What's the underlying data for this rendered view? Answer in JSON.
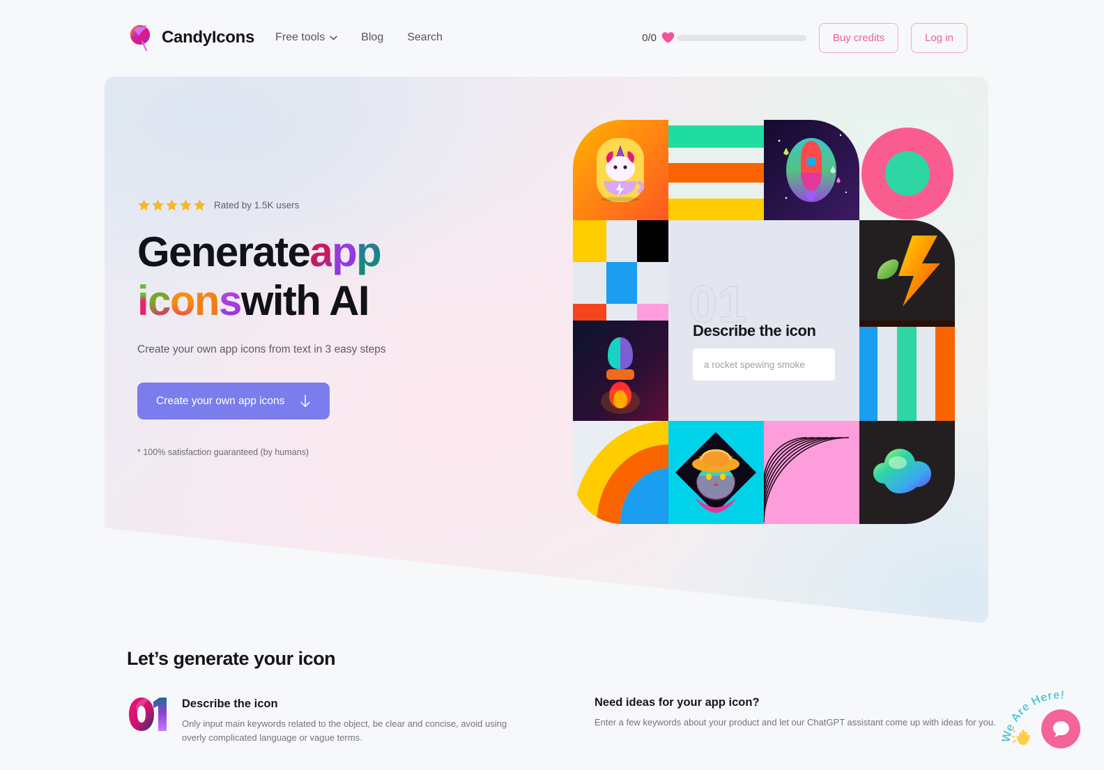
{
  "header": {
    "brand": "CandyIcons",
    "logo_icon": "candy-swirl-logo",
    "nav": [
      {
        "label": "Free tools",
        "icon": "chevron-down-icon",
        "has_caret": true
      },
      {
        "label": "Blog",
        "has_caret": false
      },
      {
        "label": "Search",
        "has_caret": false
      }
    ],
    "credits": {
      "count": "0/0",
      "icon": "heart-icon",
      "bar_fill_percent": 0
    },
    "buy_credits_label": "Buy credits",
    "login_label": "Log in",
    "accent_pink": "#ef5f95",
    "heart_color": "#f9509b"
  },
  "hero": {
    "rating": {
      "stars": 5,
      "star_icon": "star-icon",
      "text": "Rated by 1.5K users",
      "star_color": "#f5b722"
    },
    "headline_line1": [
      {
        "text": "Generate ",
        "style": "plain"
      },
      {
        "text": "a",
        "style": "c-a"
      },
      {
        "text": "p",
        "style": "c-p1"
      },
      {
        "text": "p",
        "style": "c-p2"
      }
    ],
    "headline_line2": [
      {
        "text": "i",
        "style": "c-i"
      },
      {
        "text": "c",
        "style": "c-c"
      },
      {
        "text": "o",
        "style": "c-o"
      },
      {
        "text": "n",
        "style": "c-n"
      },
      {
        "text": "s",
        "style": "c-s"
      },
      {
        "text": " with AI",
        "style": "plain"
      }
    ],
    "headline_plain": "Generate app icons with AI",
    "subheadline": "Create your own app icons from text in 3 easy steps",
    "cta_label": "Create your own app icons",
    "cta_icon": "arrow-down-icon",
    "cta_color": "#7b7ded",
    "guarantee": "* 100% satisfaction guaranteed (by humans)",
    "panel": {
      "watermark": "01",
      "title": "Describe the icon",
      "input_placeholder": "a rocket spewing smoke"
    },
    "collage": [
      {
        "name": "unicorn-in-cup-icon",
        "glyph": "unicorn-cup"
      },
      {
        "name": "stripes-teal-orange-yellow-tile",
        "glyph": "stripes"
      },
      {
        "name": "rocket-galaxy-icon",
        "glyph": "rocket-space"
      },
      {
        "name": "pink-donut-circle-tile",
        "glyph": "donut"
      },
      {
        "name": "leaf-bolt-icon",
        "glyph": "leaf-bolt"
      },
      {
        "name": "checker-squares-tile",
        "glyph": "checker"
      },
      {
        "name": "rocket-dark-icon",
        "glyph": "rocket-dark"
      },
      {
        "name": "vertical-stripes-tile",
        "glyph": "vstripes"
      },
      {
        "name": "rainbow-arc-tile",
        "glyph": "arc"
      },
      {
        "name": "cat-in-hat-icon",
        "glyph": "cat-hat"
      },
      {
        "name": "pink-line-arc-tile",
        "glyph": "line-arc"
      },
      {
        "name": "gradient-cloud-icon",
        "glyph": "cloud"
      }
    ]
  },
  "bottom": {
    "section_title": "Let’s generate your icon",
    "steps": [
      {
        "number": "01",
        "title": "Describe the icon",
        "description": "Only input main keywords related to the object, be clear and concise, avoid using overly complicated language or vague terms."
      }
    ],
    "right_panel": {
      "title": "Need ideas for your app icon?",
      "description": "Enter a few keywords about your product and let our ChatGPT assistant come up with ideas for you."
    }
  },
  "chat_widget": {
    "label": "We Are Here!",
    "bubble_icon": "chat-bubble-icon",
    "hand_icon": "waving-hand-icon",
    "bubble_color": "#f4639a",
    "label_color": "#5ec6d8"
  }
}
